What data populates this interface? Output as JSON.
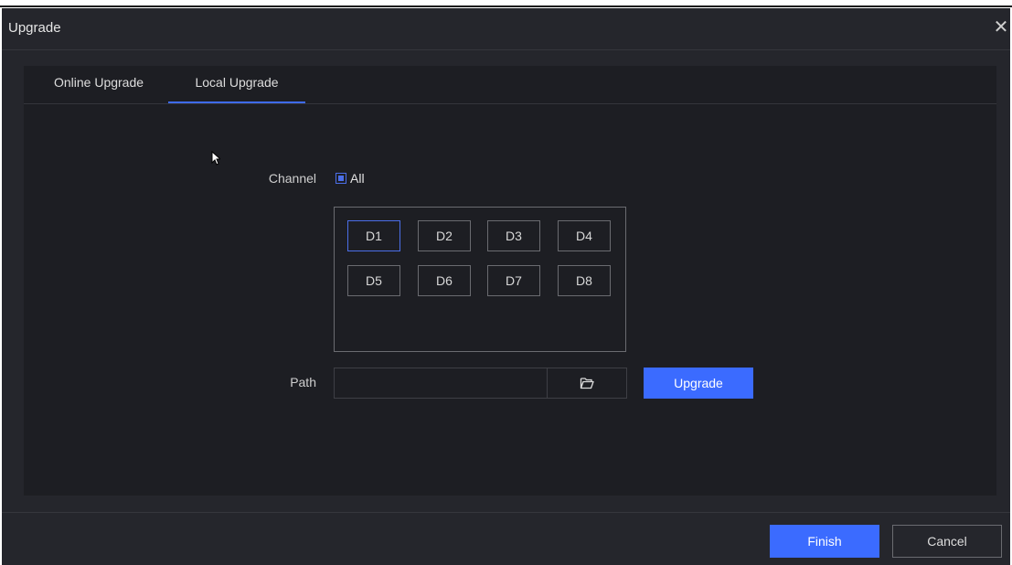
{
  "window": {
    "title": "Upgrade",
    "close_icon": "close-icon"
  },
  "tabs": [
    {
      "label": "Online Upgrade",
      "active": false
    },
    {
      "label": "Local Upgrade",
      "active": true
    }
  ],
  "channel": {
    "label": "Channel",
    "all_label": "All",
    "all_checked": true,
    "items": [
      "D1",
      "D2",
      "D3",
      "D4",
      "D5",
      "D6",
      "D7",
      "D8"
    ],
    "selected": "D1"
  },
  "path": {
    "label": "Path",
    "value": "",
    "browse_icon": "folder-open-icon"
  },
  "buttons": {
    "upgrade": "Upgrade",
    "finish": "Finish",
    "cancel": "Cancel"
  },
  "colors": {
    "accent": "#3b6bff",
    "background": "#25262c",
    "panel": "#1d1e23"
  }
}
